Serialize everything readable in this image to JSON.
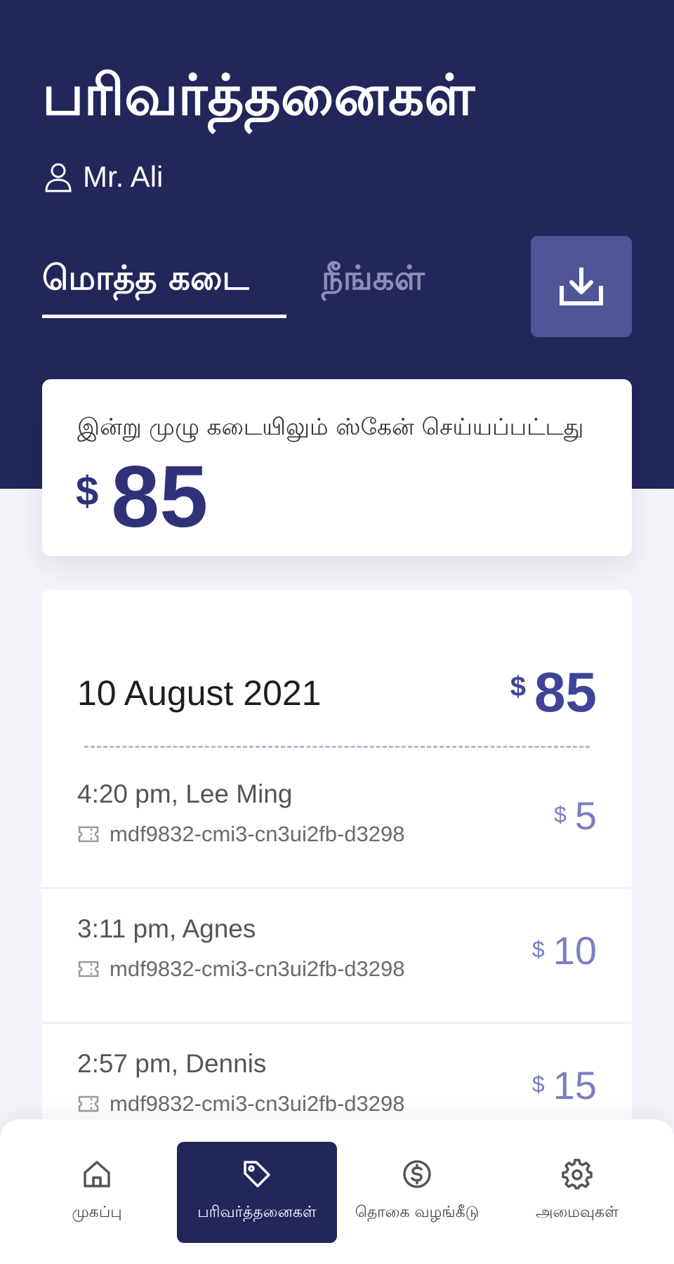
{
  "header": {
    "title": "பரிவர்த்தனைகள்",
    "user_name": "Mr. Ali"
  },
  "tabs": [
    {
      "label": "மொத்த கடை",
      "active": true
    },
    {
      "label": "நீங்கள்",
      "active": false
    }
  ],
  "download_button": {
    "icon": "download-icon"
  },
  "summary": {
    "label": "இன்று முழு கடையிலும் ஸ்கேன் செய்யப்பட்டது",
    "currency": "$",
    "amount": "85"
  },
  "day_group": {
    "date": "10 August 2021",
    "currency": "$",
    "total": "85",
    "transactions": [
      {
        "title": "4:20 pm, Lee Ming",
        "id": "mdf9832-cmi3-cn3ui2fb-d3298",
        "currency": "$",
        "amount": "5"
      },
      {
        "title": "3:11 pm, Agnes",
        "id": "mdf9832-cmi3-cn3ui2fb-d3298",
        "currency": "$",
        "amount": "10"
      },
      {
        "title": "2:57 pm, Dennis",
        "id": "mdf9832-cmi3-cn3ui2fb-d3298",
        "currency": "$",
        "amount": "15"
      }
    ]
  },
  "bottom_nav": [
    {
      "label": "முகப்பு",
      "icon": "home-icon",
      "active": false
    },
    {
      "label": "பரிவர்த்தனைகள்",
      "icon": "tag-icon",
      "active": true
    },
    {
      "label": "தொகை வழங்கீடு",
      "icon": "dollar-circle-icon",
      "active": false
    },
    {
      "label": "அமைவுகள்",
      "icon": "gear-icon",
      "active": false
    }
  ],
  "colors": {
    "header_bg": "#22265a",
    "accent": "#2f3278",
    "button_bg": "#4f5597",
    "amount_light": "#7b7fc0"
  }
}
